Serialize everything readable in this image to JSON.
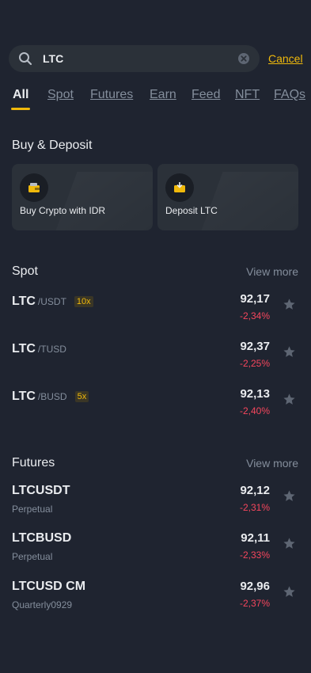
{
  "search": {
    "value": "LTC",
    "cancel_label": "Cancel"
  },
  "tabs": [
    "All",
    "Spot",
    "Futures",
    "Earn",
    "Feed",
    "NFT",
    "FAQs"
  ],
  "buy_deposit": {
    "title": "Buy & Deposit",
    "cards": [
      {
        "label": "Buy Crypto with IDR",
        "icon": "wallet-icon"
      },
      {
        "label": "Deposit LTC",
        "icon": "deposit-icon"
      }
    ]
  },
  "spot": {
    "title": "Spot",
    "view_more": "View more",
    "items": [
      {
        "base": "LTC",
        "quote": "/USDT",
        "leverage": "10x",
        "price": "92,17",
        "change": "-2,34%"
      },
      {
        "base": "LTC",
        "quote": "/TUSD",
        "leverage": "",
        "price": "92,37",
        "change": "-2,25%"
      },
      {
        "base": "LTC",
        "quote": "/BUSD",
        "leverage": "5x",
        "price": "92,13",
        "change": "-2,40%"
      }
    ]
  },
  "futures": {
    "title": "Futures",
    "view_more": "View more",
    "items": [
      {
        "symbol": "LTCUSDT",
        "type": "Perpetual",
        "price": "92,12",
        "change": "-2,31%"
      },
      {
        "symbol": "LTCBUSD",
        "type": "Perpetual",
        "price": "92,11",
        "change": "-2,33%"
      },
      {
        "symbol": "LTCUSD CM",
        "type": "Quarterly0929",
        "price": "92,96",
        "change": "-2,37%"
      }
    ]
  },
  "colors": {
    "accent": "#f0b90b",
    "negative": "#f6465d",
    "background": "#1f2430",
    "card": "#2b3139"
  }
}
